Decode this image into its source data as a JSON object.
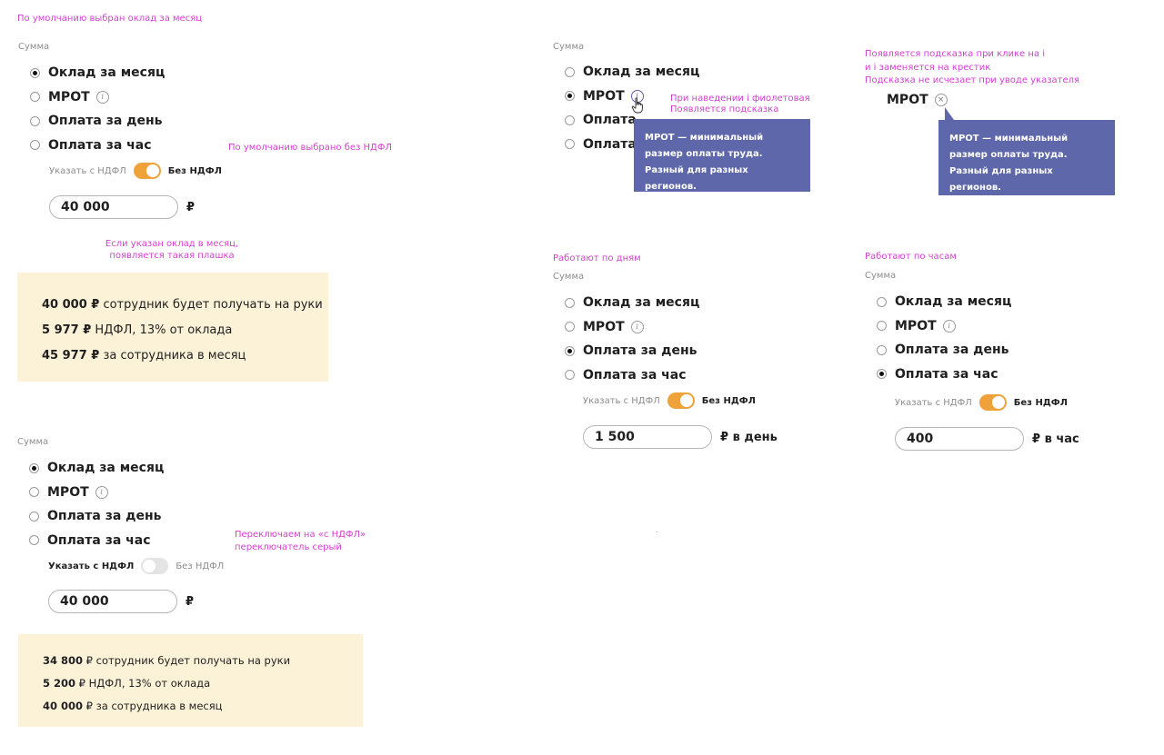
{
  "annotations": {
    "default_monthly": "По умолчанию выбран оклад за месяц",
    "default_without_ndfl": "По умолчанию выбрано без НДФЛ",
    "plate_line1": "Если указан оклад в месяц,",
    "plate_line2": "появляется такая плашка",
    "hover_line1": "При наведении i фиолетовая",
    "hover_line2": "Появляется подсказка",
    "click_line1": "Появляется подсказка при клике на i",
    "click_line2": "и i заменяется на крестик",
    "click_line3": "Подсказка не исчезает при уводе указателя",
    "days": "Работают по дням",
    "hours": "Работают по часам",
    "switch_line1": "Переключаем на «с НДФЛ»",
    "switch_line2": "переключатель серый"
  },
  "common": {
    "sum_label": "Сумма",
    "opt_month": "Оклад за месяц",
    "opt_mrot": "МРОТ",
    "opt_day": "Оплата за день",
    "opt_hour": "Оплата за час",
    "opt_day_cut": "Оплата",
    "opt_hour_cut": "Оплата",
    "info_glyph": "i",
    "close_glyph": "×",
    "ndfl_with": "Указать с НДФЛ",
    "ndfl_without": "Без НДФЛ",
    "currency": "₽",
    "per_day": "₽ в день",
    "per_hour": "₽ в час",
    "tooltip_text": "МРОТ — минимальный размер оплаты труда. Разный для разных регионов."
  },
  "block1": {
    "amount": "40 000",
    "summary": {
      "l1_bold": "40 000 ₽",
      "l1_text": " сотрудник будет получать на руки",
      "l2_bold": "5 977 ₽",
      "l2_text": " НДФЛ,  13% от оклада",
      "l3_bold": "45 977 ₽",
      "l3_text": " за сотрудника в месяц"
    }
  },
  "block_days": {
    "amount": "1 500"
  },
  "block_hours": {
    "amount": "400"
  },
  "block4": {
    "amount": "40 000",
    "summary": {
      "l1_bold": "34 800",
      "l1_text": " ₽ сотрудник будет получать на руки",
      "l2_bold": "5 200",
      "l2_text": " ₽ НДФЛ,  13% от оклада",
      "l3_bold": "40 000",
      "l3_text": " ₽ за сотрудника в месяц"
    }
  },
  "colors": {
    "annotation": "#d43fd0",
    "toggle_on": "#f0a23a",
    "toggle_off": "#e4e4e4",
    "tooltip_bg": "#5d67a9",
    "summary_bg": "#fcf2d8"
  },
  "icons": [
    "info-icon",
    "close-icon",
    "hand-pointer-icon"
  ]
}
